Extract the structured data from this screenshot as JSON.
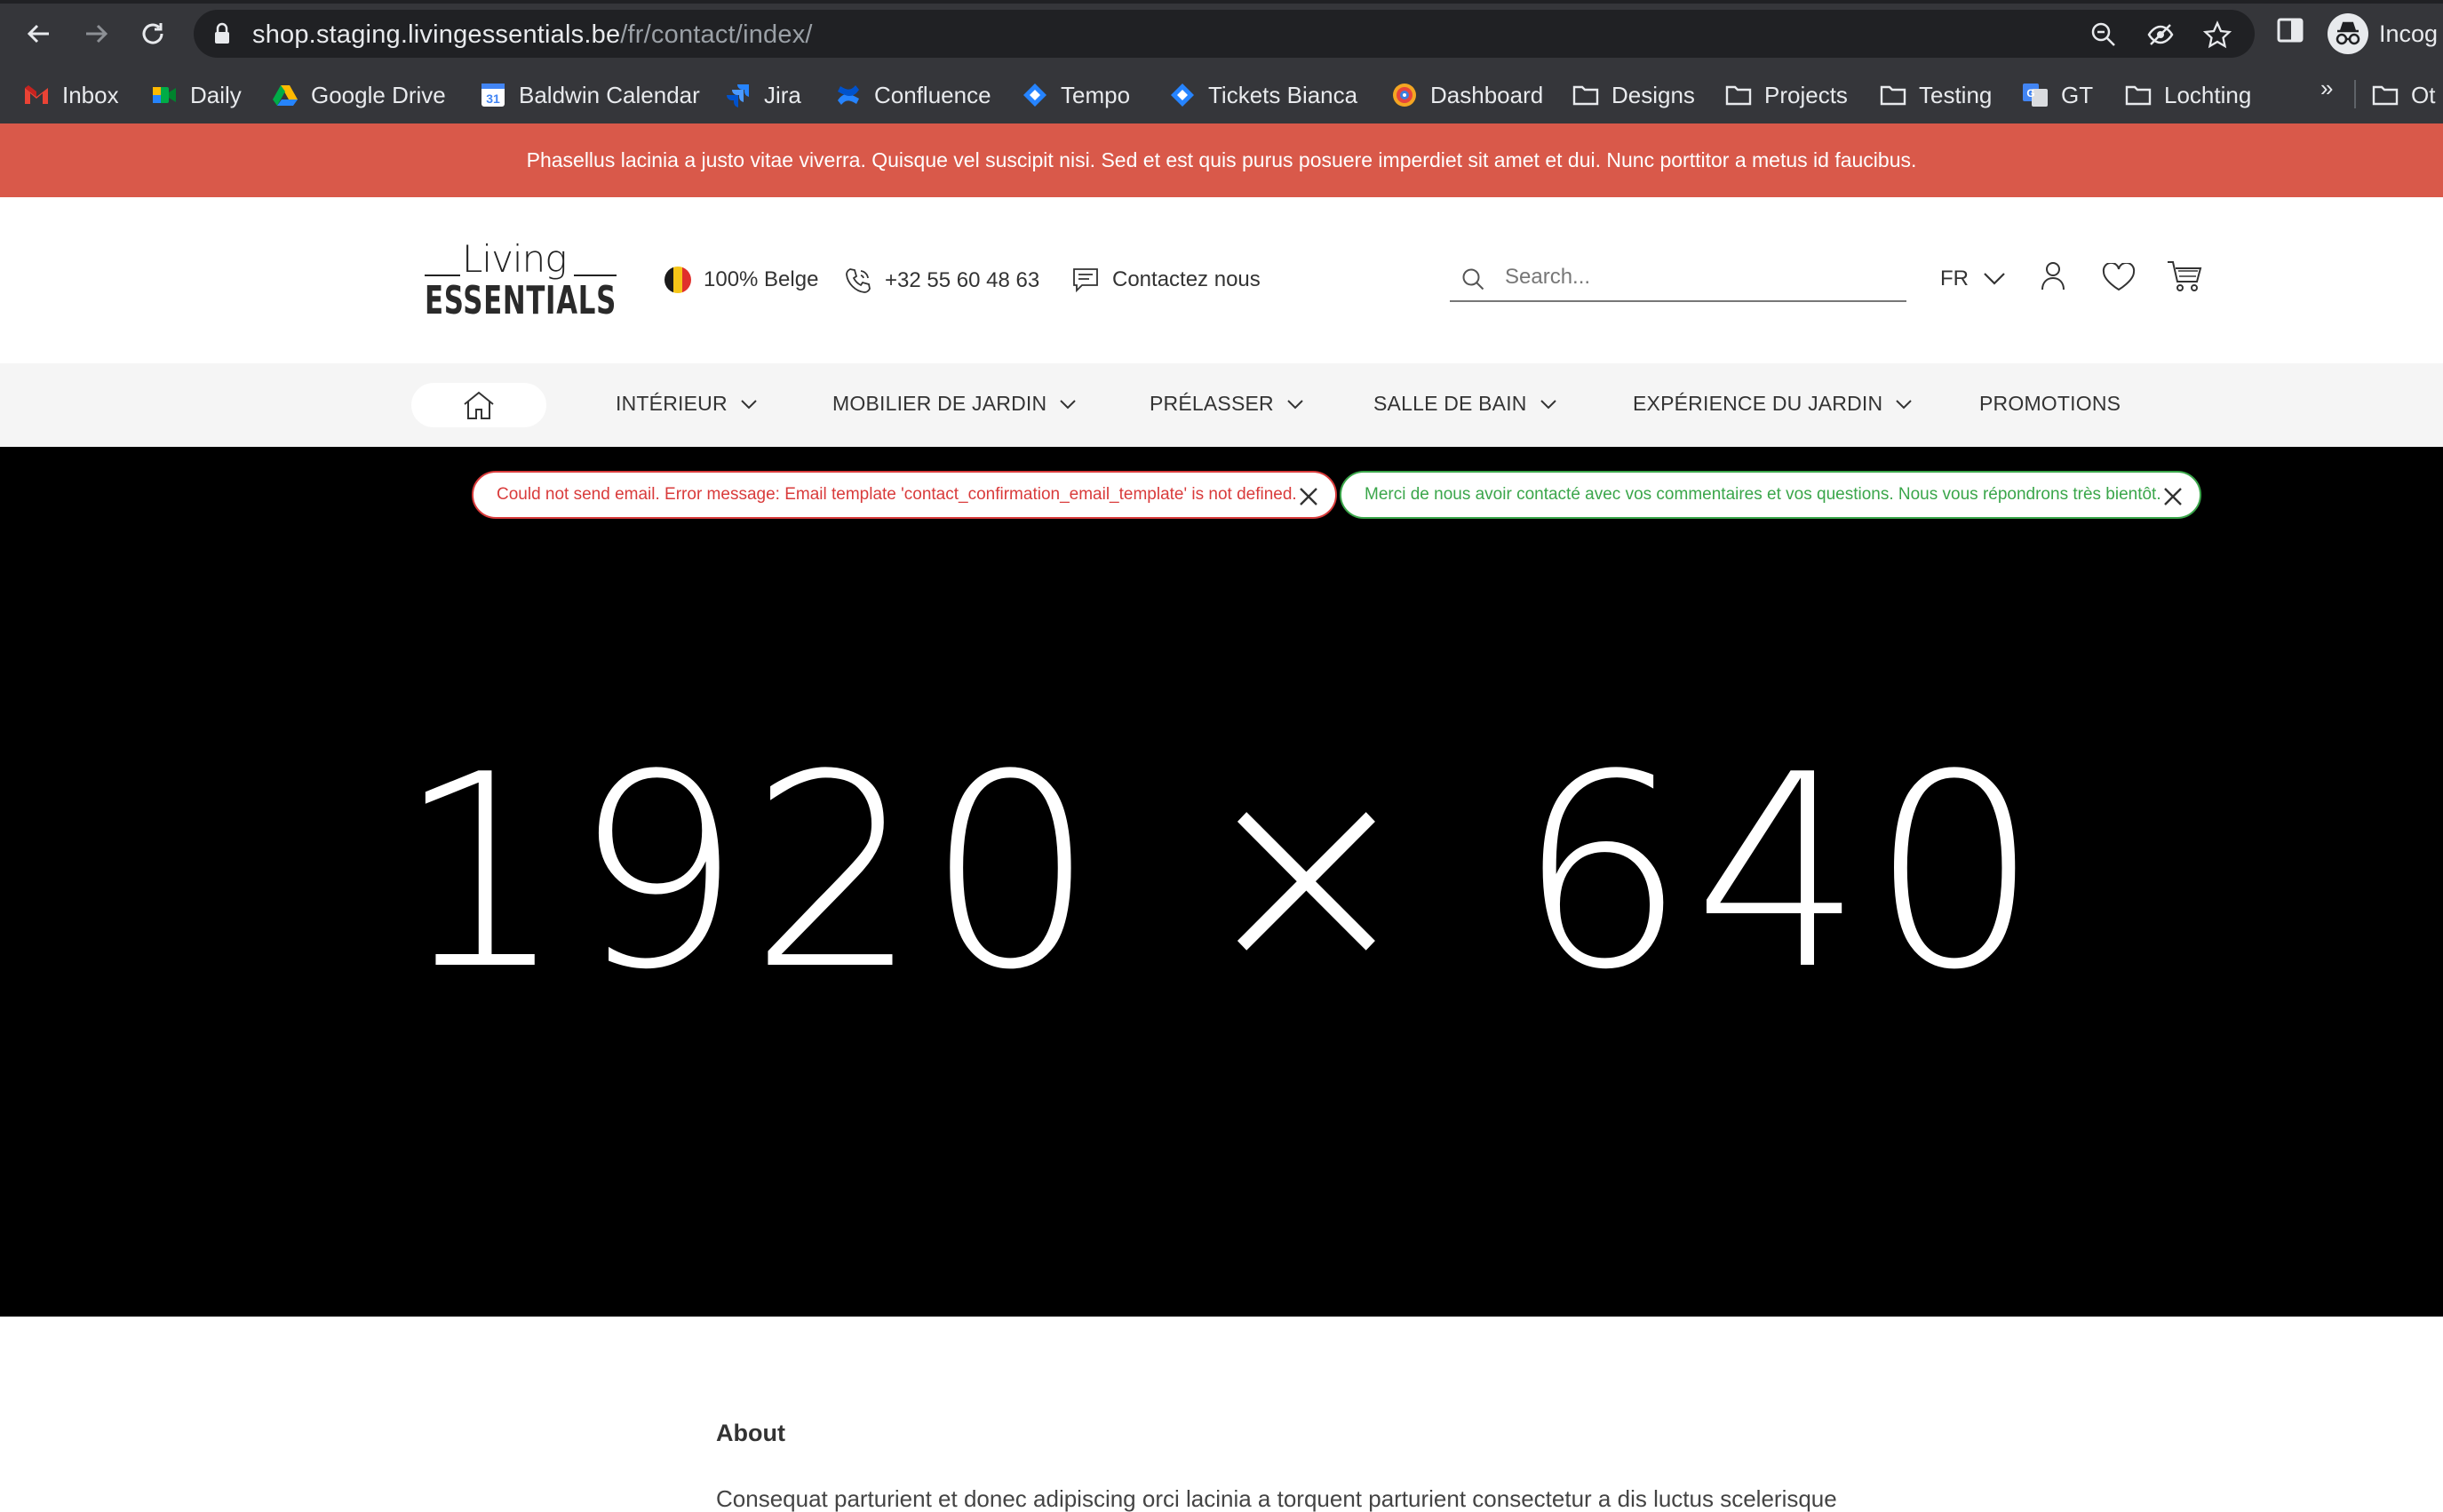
{
  "browser": {
    "url_host": "shop.staging.livingessentials.be",
    "url_path": "/fr/contact/index/",
    "profile_label": "Incog",
    "bookmarks": [
      {
        "label": "Inbox",
        "icon": "gmail-icon"
      },
      {
        "label": "Daily",
        "icon": "meet-icon"
      },
      {
        "label": "Google Drive",
        "icon": "drive-icon"
      },
      {
        "label": "Baldwin Calendar",
        "icon": "calendar-icon"
      },
      {
        "label": "Jira",
        "icon": "jira-icon"
      },
      {
        "label": "Confluence",
        "icon": "confluence-icon"
      },
      {
        "label": "Tempo",
        "icon": "tempo-icon"
      },
      {
        "label": "Tickets Bianca",
        "icon": "jira-icon"
      },
      {
        "label": "Dashboard",
        "icon": "dashboard-icon"
      },
      {
        "label": "Designs",
        "icon": "folder-icon"
      },
      {
        "label": "Projects",
        "icon": "folder-icon"
      },
      {
        "label": "Testing",
        "icon": "folder-icon"
      },
      {
        "label": "GT",
        "icon": "translate-icon"
      },
      {
        "label": "Lochting",
        "icon": "folder-icon"
      }
    ],
    "bookmarks_more": "»",
    "bookmarks_other": "Ot"
  },
  "promo": {
    "text": "Phasellus lacinia a justo vitae viverra. Quisque vel suscipit nisi. Sed et est quis purus posuere imperdiet sit amet et dui. Nunc porttitor a metus id faucibus.",
    "background": "#d9594a"
  },
  "header": {
    "logo_top": "Living",
    "logo_bottom": "ESSENTIALS",
    "usp_belge": "100% Belge",
    "usp_phone": "+32 55 60 48 63",
    "usp_contact": "Contactez nous",
    "search_placeholder": "Search...",
    "language": "FR"
  },
  "nav": {
    "items": [
      {
        "label": "INTÉRIEUR",
        "dropdown": true
      },
      {
        "label": "MOBILIER DE JARDIN",
        "dropdown": true
      },
      {
        "label": "PRÉLASSER",
        "dropdown": true
      },
      {
        "label": "SALLE DE BAIN",
        "dropdown": true
      },
      {
        "label": "EXPÉRIENCE DU JARDIN",
        "dropdown": true
      },
      {
        "label": "PROMOTIONS",
        "dropdown": false
      }
    ]
  },
  "messages": {
    "error": "Could not send email. Error message: Email template 'contact_confirmation_email_template' is not defined.",
    "success": "Merci de nous avoir contacté avec vos commentaires et vos questions. Nous vous répondrons très bientôt.",
    "error_color": "#d93b3b",
    "success_color": "#3aa64a"
  },
  "hero": {
    "placeholder_text": "1920 × 640"
  },
  "content": {
    "about_title": "About",
    "about_text": "Consequat parturient et donec adipiscing orci lacinia a torquent parturient consectetur a dis luctus scelerisque"
  }
}
